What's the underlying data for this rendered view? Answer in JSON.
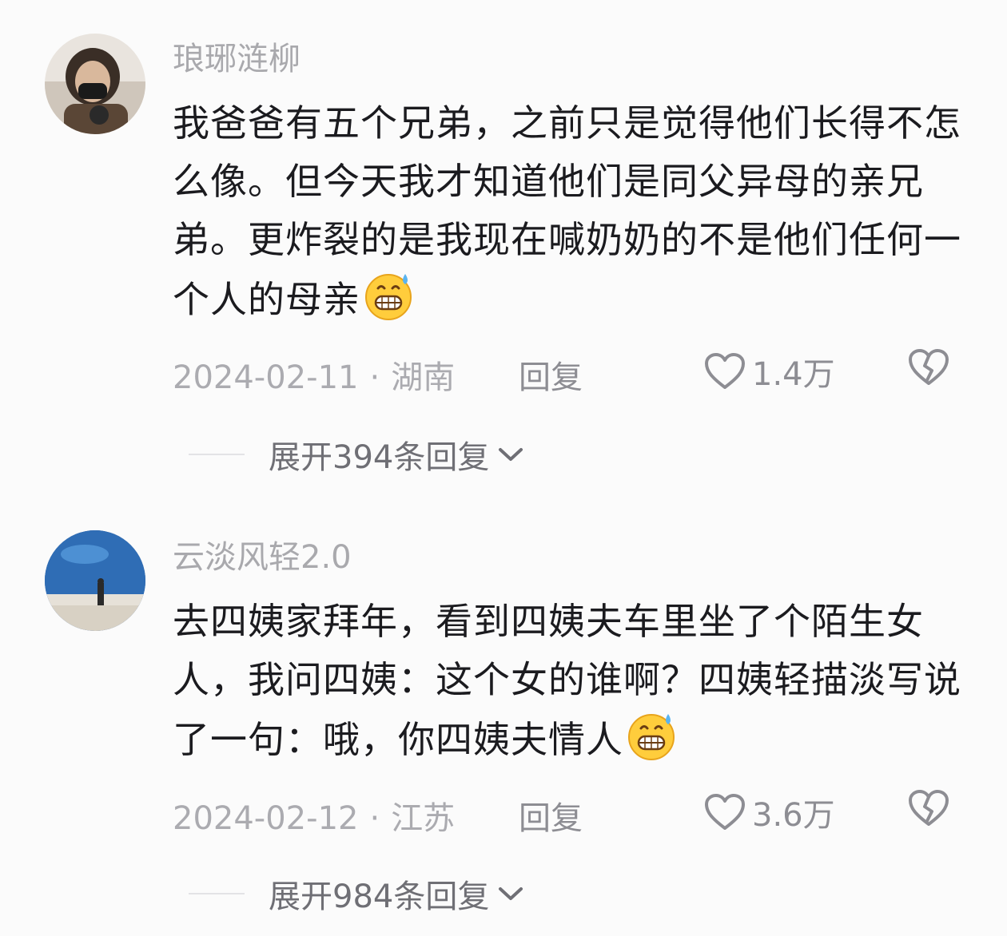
{
  "comments": [
    {
      "username": "琅琊涟柳",
      "text": "我爸爸有五个兄弟，之前只是觉得他们长得不怎么像。但今天我才知道他们是同父异母的亲兄弟。更炸裂的是我现在喊奶奶的不是他们任何一个人的母亲",
      "emoji": "grimace-sweat-emoji",
      "date": "2024-02-11",
      "separator": "·",
      "location": "湖南",
      "reply_label": "回复",
      "likes": "1.4万",
      "expand_label": "展开394条回复",
      "avatar": "person-avatar"
    },
    {
      "username": "云淡风轻2.0",
      "text": "去四姨家拜年，看到四姨夫车里坐了个陌生女人，我问四姨：这个女的谁啊？四姨轻描淡写说了一句：哦，你四姨夫情人",
      "emoji": "grimace-sweat-emoji",
      "date": "2024-02-12",
      "separator": "·",
      "location": "江苏",
      "reply_label": "回复",
      "likes": "3.6万",
      "expand_label": "展开984条回复",
      "avatar": "aquarium-avatar"
    }
  ],
  "colors": {
    "background": "#fbfbfb",
    "text": "#1b1b1f",
    "muted": "#a9a9ad",
    "action": "#8d8d93"
  },
  "icons": [
    "heart-outline-icon",
    "broken-heart-icon",
    "chevron-down-icon"
  ]
}
